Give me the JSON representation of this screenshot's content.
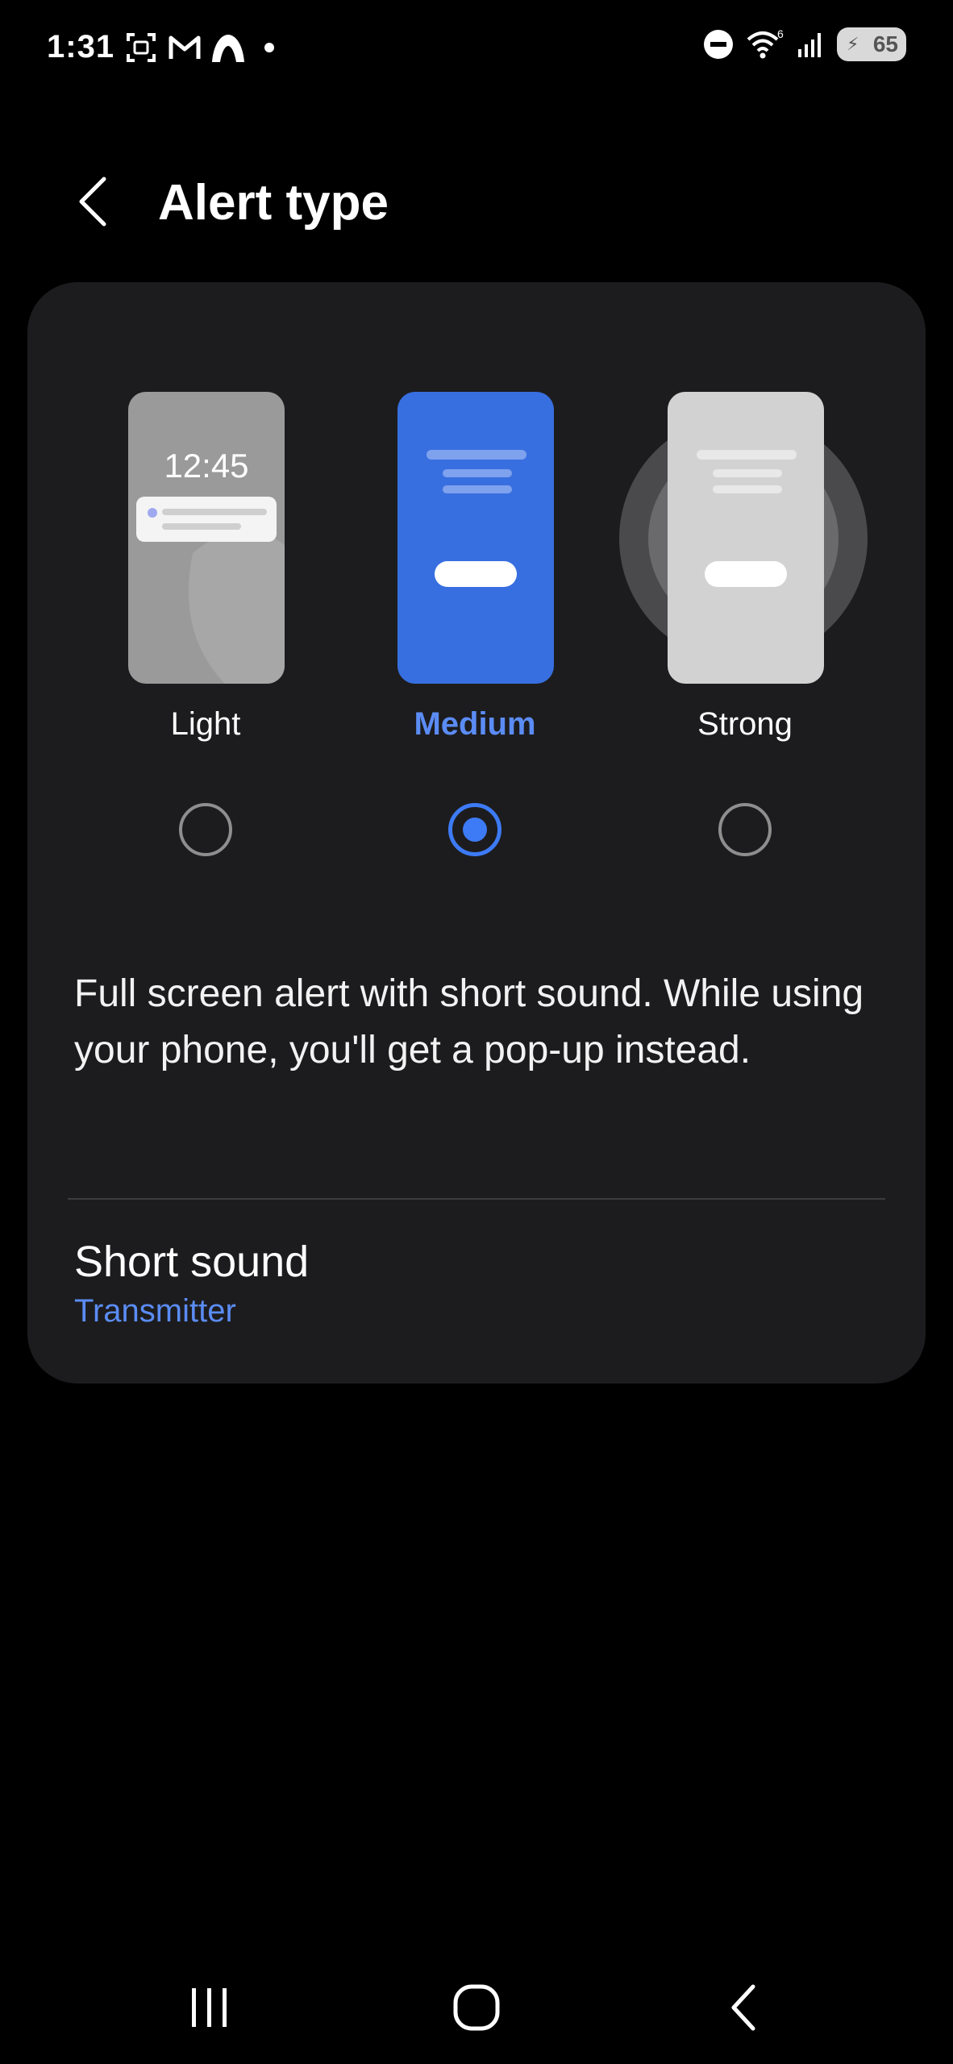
{
  "status_bar": {
    "time": "1:31",
    "left_icons": [
      "screenshot-icon",
      "gmail-icon",
      "app-icon"
    ],
    "right_icons": [
      "do-not-disturb-icon",
      "wifi-icon",
      "signal-icon"
    ],
    "wifi_badge": "6",
    "battery": "65"
  },
  "header": {
    "title": "Alert type"
  },
  "alert_options": [
    {
      "label": "Light",
      "preview_time": "12:45",
      "selected": false
    },
    {
      "label": "Medium",
      "selected": true
    },
    {
      "label": "Strong",
      "selected": false
    }
  ],
  "description": "Full screen alert with short sound. While using your phone, you'll get a pop-up instead.",
  "short_sound": {
    "title": "Short sound",
    "value": "Transmitter"
  },
  "colors": {
    "accent": "#3d7af5",
    "accent_text": "#5b8cf5",
    "card_bg": "#1c1c1e",
    "background": "#000000"
  }
}
